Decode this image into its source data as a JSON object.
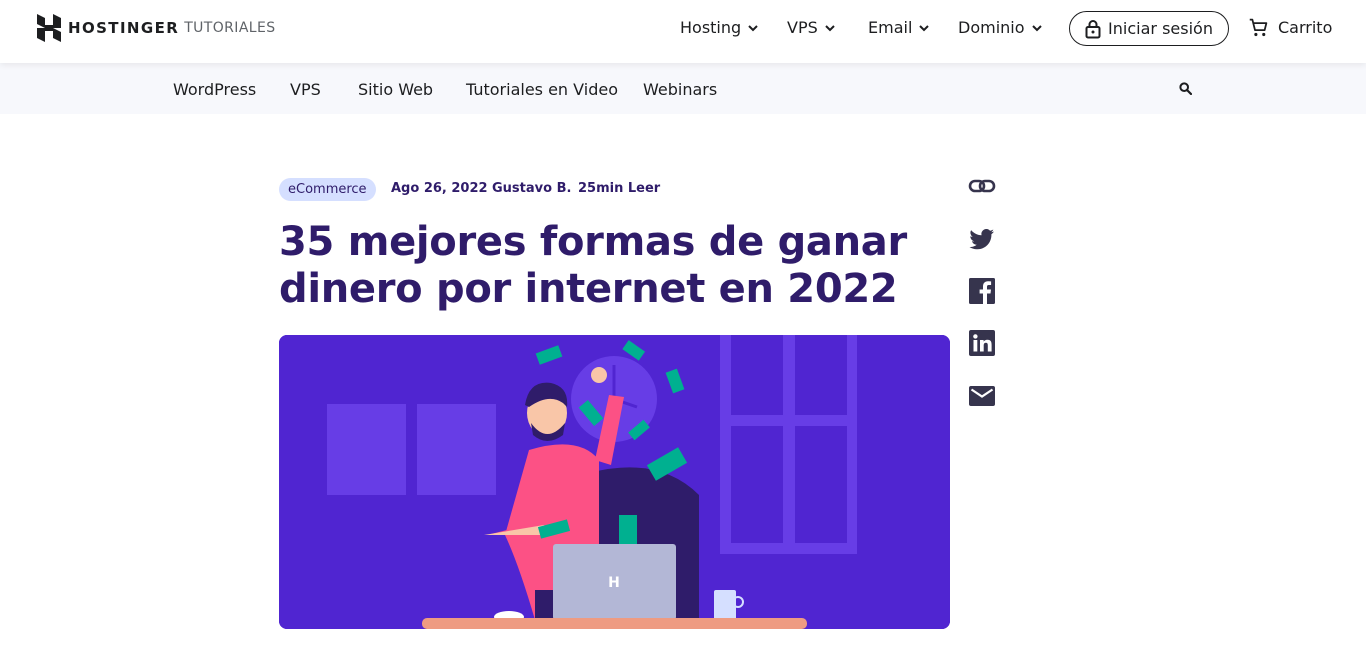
{
  "header": {
    "brand": "HOSTINGER",
    "brand_sub": "TUTORIALES",
    "nav": [
      {
        "label": "Hosting"
      },
      {
        "label": "VPS"
      },
      {
        "label": "Email"
      },
      {
        "label": "Dominio"
      }
    ],
    "login_label": "Iniciar sesión",
    "cart_label": "Carrito"
  },
  "subnav": {
    "items": [
      {
        "label": "WordPress"
      },
      {
        "label": "VPS"
      },
      {
        "label": "Sitio Web"
      },
      {
        "label": "Tutoriales en Video"
      },
      {
        "label": "Webinars"
      }
    ],
    "search_icon": "search-icon"
  },
  "article": {
    "category": "eCommerce",
    "date": "Ago 26, 2022",
    "author": "Gustavo B.",
    "read_time": "25min Leer",
    "title": "35 mejores formas de ganar dinero por internet en 2022",
    "hero_logo_letter": "H"
  },
  "share": {
    "icons": [
      "link-icon",
      "twitter-icon",
      "facebook-icon",
      "linkedin-icon",
      "email-icon"
    ]
  },
  "colors": {
    "brand_purple": "#5025d1",
    "title_color": "#2f1c6a",
    "tag_bg": "#d5dfff",
    "subnav_bg": "#f7f8fc"
  }
}
